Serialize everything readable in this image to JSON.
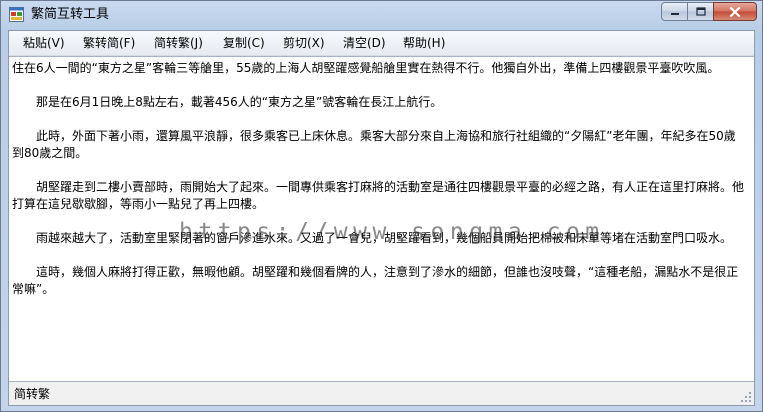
{
  "window": {
    "title": "繁简互转工具"
  },
  "menu": [
    {
      "label": "粘贴(V)"
    },
    {
      "label": "繁转简(F)"
    },
    {
      "label": "简转繁(J)"
    },
    {
      "label": "复制(C)"
    },
    {
      "label": "剪切(X)"
    },
    {
      "label": "清空(D)"
    },
    {
      "label": "帮助(H)"
    }
  ],
  "editor": {
    "lines": [
      "住在6人一間的“東方之星”客輪三等艙里，55歲的上海人胡堅躍感覺船艙里實在熱得不行。他獨自外出，準備上四樓觀景平臺吹吹風。",
      "",
      "　　那是在6月1日晚上8點左右，載著456人的“東方之星”號客輪在長江上航行。",
      "",
      "　　此時，外面下著小雨，還算風平浪靜，很多乘客已上床休息。乘客大部分來自上海協和旅行社組織的“夕陽紅”老年團，年紀多在50歲",
      "到80歲之間。",
      "",
      "　　胡堅躍走到二樓小賣部時，雨開始大了起來。一間專供乘客打麻將的活動室是通往四樓觀景平臺的必經之路，有人正在這里打麻將。他",
      "打算在這兒歇歇腳，等雨小一點兒了再上四樓。",
      "",
      "　　雨越來越大了，活動室里緊閉著的窗戶滲進水來。又過了一會兒，胡堅躍看到，幾個船員開始把棉被和床單等堵在活動室門口吸水。",
      "",
      "　　這時，幾個人麻將打得正歡，無暇他顧。胡堅躍和幾個看牌的人，注意到了滲水的細節，但誰也沒吱聲，“這種老船，漏點水不是很正",
      "常嘛”。"
    ]
  },
  "watermark": "https://www.songma.com",
  "status": {
    "label": "简转繁"
  },
  "colors": {
    "titlebar": "#c9daf0",
    "close_button": "#c34a35",
    "editor_background": "#ffffff"
  }
}
